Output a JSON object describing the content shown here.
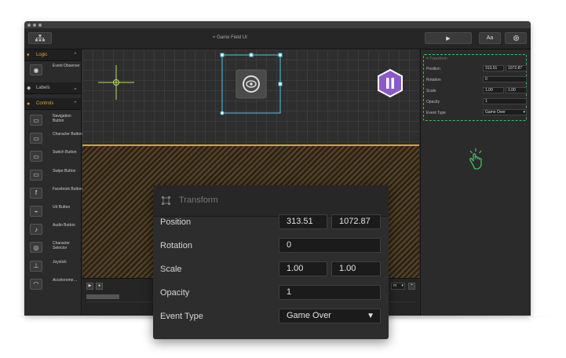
{
  "window": {
    "title": "Game Field UI"
  },
  "toolbar": {
    "play_icon": "▶",
    "font_button_label": "Aa",
    "settings_icon": "gear-icon"
  },
  "sidebar": {
    "sections": [
      {
        "label": "Logic",
        "icon": "▾"
      },
      {
        "label": "Labels",
        "icon": "◆"
      },
      {
        "label": "Controls",
        "icon": "●"
      }
    ],
    "logic_items": [
      {
        "label": "Event Observer",
        "icon": "◉"
      }
    ],
    "control_items": [
      {
        "label": "Navigation Button",
        "icon": "▭"
      },
      {
        "label": "Character Button",
        "icon": "▭"
      },
      {
        "label": "Switch Button",
        "icon": "▭"
      },
      {
        "label": "Swipe Button",
        "icon": "▭"
      },
      {
        "label": "Facebook Button",
        "icon": "f"
      },
      {
        "label": "Url Button",
        "icon": "⌁"
      },
      {
        "label": "Audio Button",
        "icon": "♪"
      },
      {
        "label": "Character Selector",
        "icon": "◎"
      },
      {
        "label": "Joystick",
        "icon": "⊥"
      },
      {
        "label": "Accelerome…",
        "icon": "◠"
      }
    ]
  },
  "timeline": {
    "dropdown_text": "m"
  },
  "inspector_small": {
    "title": "Transform",
    "position_label": "Position",
    "position_x": "313.51",
    "position_y": "1072.87",
    "rotation_label": "Rotation",
    "rotation": "0",
    "scale_label": "Scale",
    "scale_x": "1.00",
    "scale_y": "1.00",
    "opacity_label": "Opacity",
    "opacity": "1",
    "event_type_label": "Event Type",
    "event_type": "Game Over"
  },
  "inspector_zoom": {
    "title": "Transform",
    "position_label": "Position",
    "position_x": "313.51",
    "position_y": "1072.87",
    "rotation_label": "Rotation",
    "rotation": "0",
    "scale_label": "Scale",
    "scale_x": "1.00",
    "scale_y": "1.00",
    "opacity_label": "Opacity",
    "opacity": "1",
    "event_type_label": "Event Type",
    "event_type": "Game Over"
  },
  "colors": {
    "accent_orange": "#f0a020",
    "selection_cyan": "#4ec8e8",
    "dashed_green": "#3fbf5a",
    "crosshair": "#b8e060",
    "badge_purple": "#8a5ac8"
  }
}
